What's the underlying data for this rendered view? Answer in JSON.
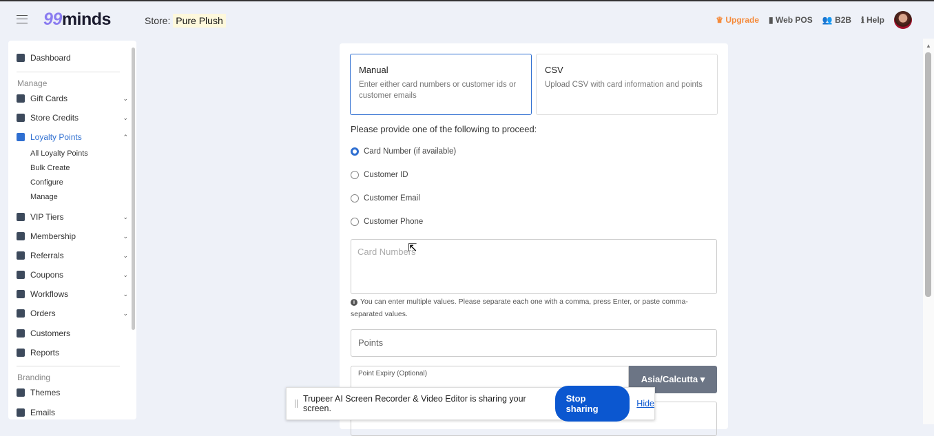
{
  "header": {
    "logo_num": "99",
    "logo_text": "minds",
    "store_label": "Store:",
    "store_name": "Pure Plush",
    "upgrade": "Upgrade",
    "web_pos": "Web POS",
    "b2b": "B2B",
    "help": "Help"
  },
  "sidebar": {
    "dashboard": "Dashboard",
    "manage_section": "Manage",
    "items": [
      {
        "label": "Gift Cards"
      },
      {
        "label": "Store Credits"
      },
      {
        "label": "Loyalty Points"
      },
      {
        "label": "VIP Tiers"
      },
      {
        "label": "Membership"
      },
      {
        "label": "Referrals"
      },
      {
        "label": "Coupons"
      },
      {
        "label": "Workflows"
      },
      {
        "label": "Orders"
      },
      {
        "label": "Customers"
      },
      {
        "label": "Reports"
      }
    ],
    "loyalty_sub": [
      "All Loyalty Points",
      "Bulk Create",
      "Configure",
      "Manage"
    ],
    "branding_section": "Branding",
    "themes": "Themes",
    "emails": "Emails"
  },
  "main": {
    "manual_title": "Manual",
    "manual_desc": "Enter either card numbers or customer ids or customer emails",
    "csv_title": "CSV",
    "csv_desc": "Upload CSV with card information and points",
    "prompt": "Please provide one of the following to proceed:",
    "radios": [
      "Card Number (if available)",
      "Customer ID",
      "Customer Email",
      "Customer Phone"
    ],
    "card_numbers_placeholder": "Card Numbers",
    "hint": "You can enter multiple values. Please separate each one with a comma, press Enter, or paste comma-separated values.",
    "points_placeholder": "Points",
    "expiry_label": "Point Expiry (Optional)",
    "timezone": "Asia/Calcutta ▾"
  },
  "share_bar": {
    "text": "Trupeer AI Screen Recorder & Video Editor is sharing your screen.",
    "stop": "Stop sharing",
    "hide": "Hide"
  }
}
